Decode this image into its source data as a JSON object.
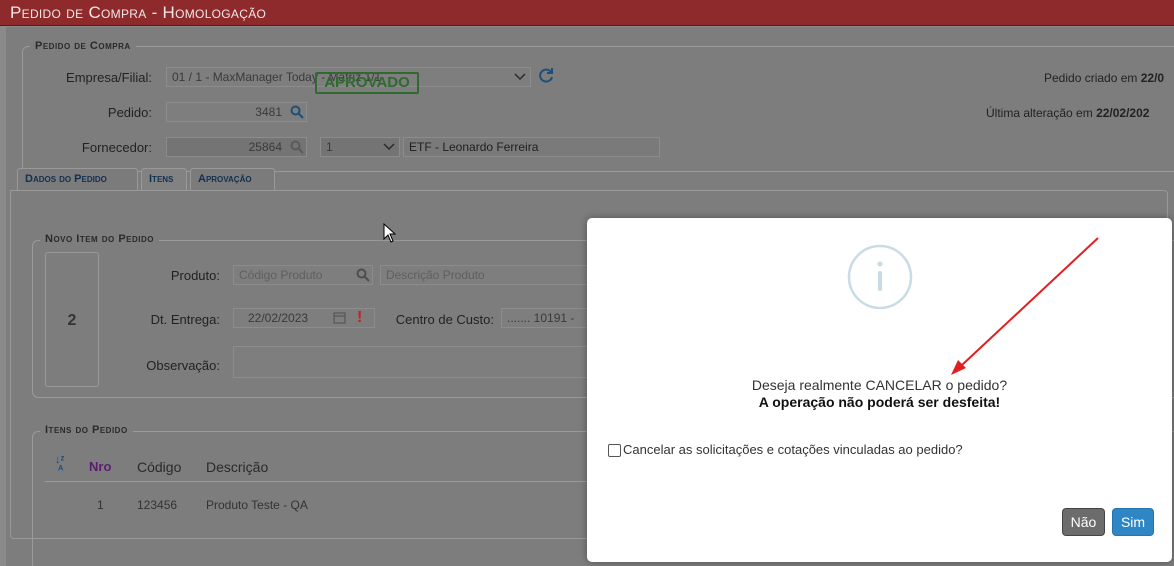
{
  "window": {
    "title": "Pedido de Compra - Homologação"
  },
  "header_section": {
    "legend": "Pedido de Compra",
    "empresa_label": "Empresa/Filial:",
    "empresa_value": "01 / 1 - MaxManager Today - Matriz 1/1",
    "pedido_label": "Pedido:",
    "pedido_value": "3481",
    "status": "APROVADO",
    "fornecedor_label": "Fornecedor:",
    "fornecedor_code": "25864",
    "fornecedor_select": "1",
    "fornecedor_name": "ETF - Leonardo Ferreira",
    "created_label": "Pedido criado em",
    "created_value": "22/0",
    "altered_label": "Última alteração em",
    "altered_value": "22/02/202"
  },
  "tabs": [
    {
      "label": "Dados do Pedido"
    },
    {
      "label": "Itens"
    },
    {
      "label": "Aprovação"
    }
  ],
  "novo_item": {
    "legend": "Novo Item do Pedido",
    "number": "2",
    "produto_label": "Produto:",
    "produto_code_placeholder": "Código Produto",
    "produto_desc_placeholder": "Descrição Produto",
    "entrega_label": "Dt. Entrega:",
    "entrega_value": "22/02/2023",
    "centro_label": "Centro de Custo:",
    "centro_value": "....... 10191 -",
    "obs_label": "Observação:"
  },
  "itens": {
    "legend": "Itens do Pedido",
    "columns": [
      "Nro",
      "Código",
      "Descrição"
    ],
    "rows": [
      {
        "nro": "1",
        "codigo": "123456",
        "descricao": "Produto Teste - QA"
      }
    ]
  },
  "dialog": {
    "message": "Deseja realmente CANCELAR o pedido?",
    "warning": "A operação não poderá ser desfeita!",
    "checkbox_label": "Cancelar as solicitações e cotações vinculadas ao pedido?",
    "no_label": "Não",
    "yes_label": "Sim"
  },
  "colors": {
    "titlebar": "#8f2a2c",
    "status_green": "#2f6b2f",
    "yes_button": "#2e86c4",
    "no_button": "#6c6c6c",
    "annotation_arrow": "#e02020"
  }
}
